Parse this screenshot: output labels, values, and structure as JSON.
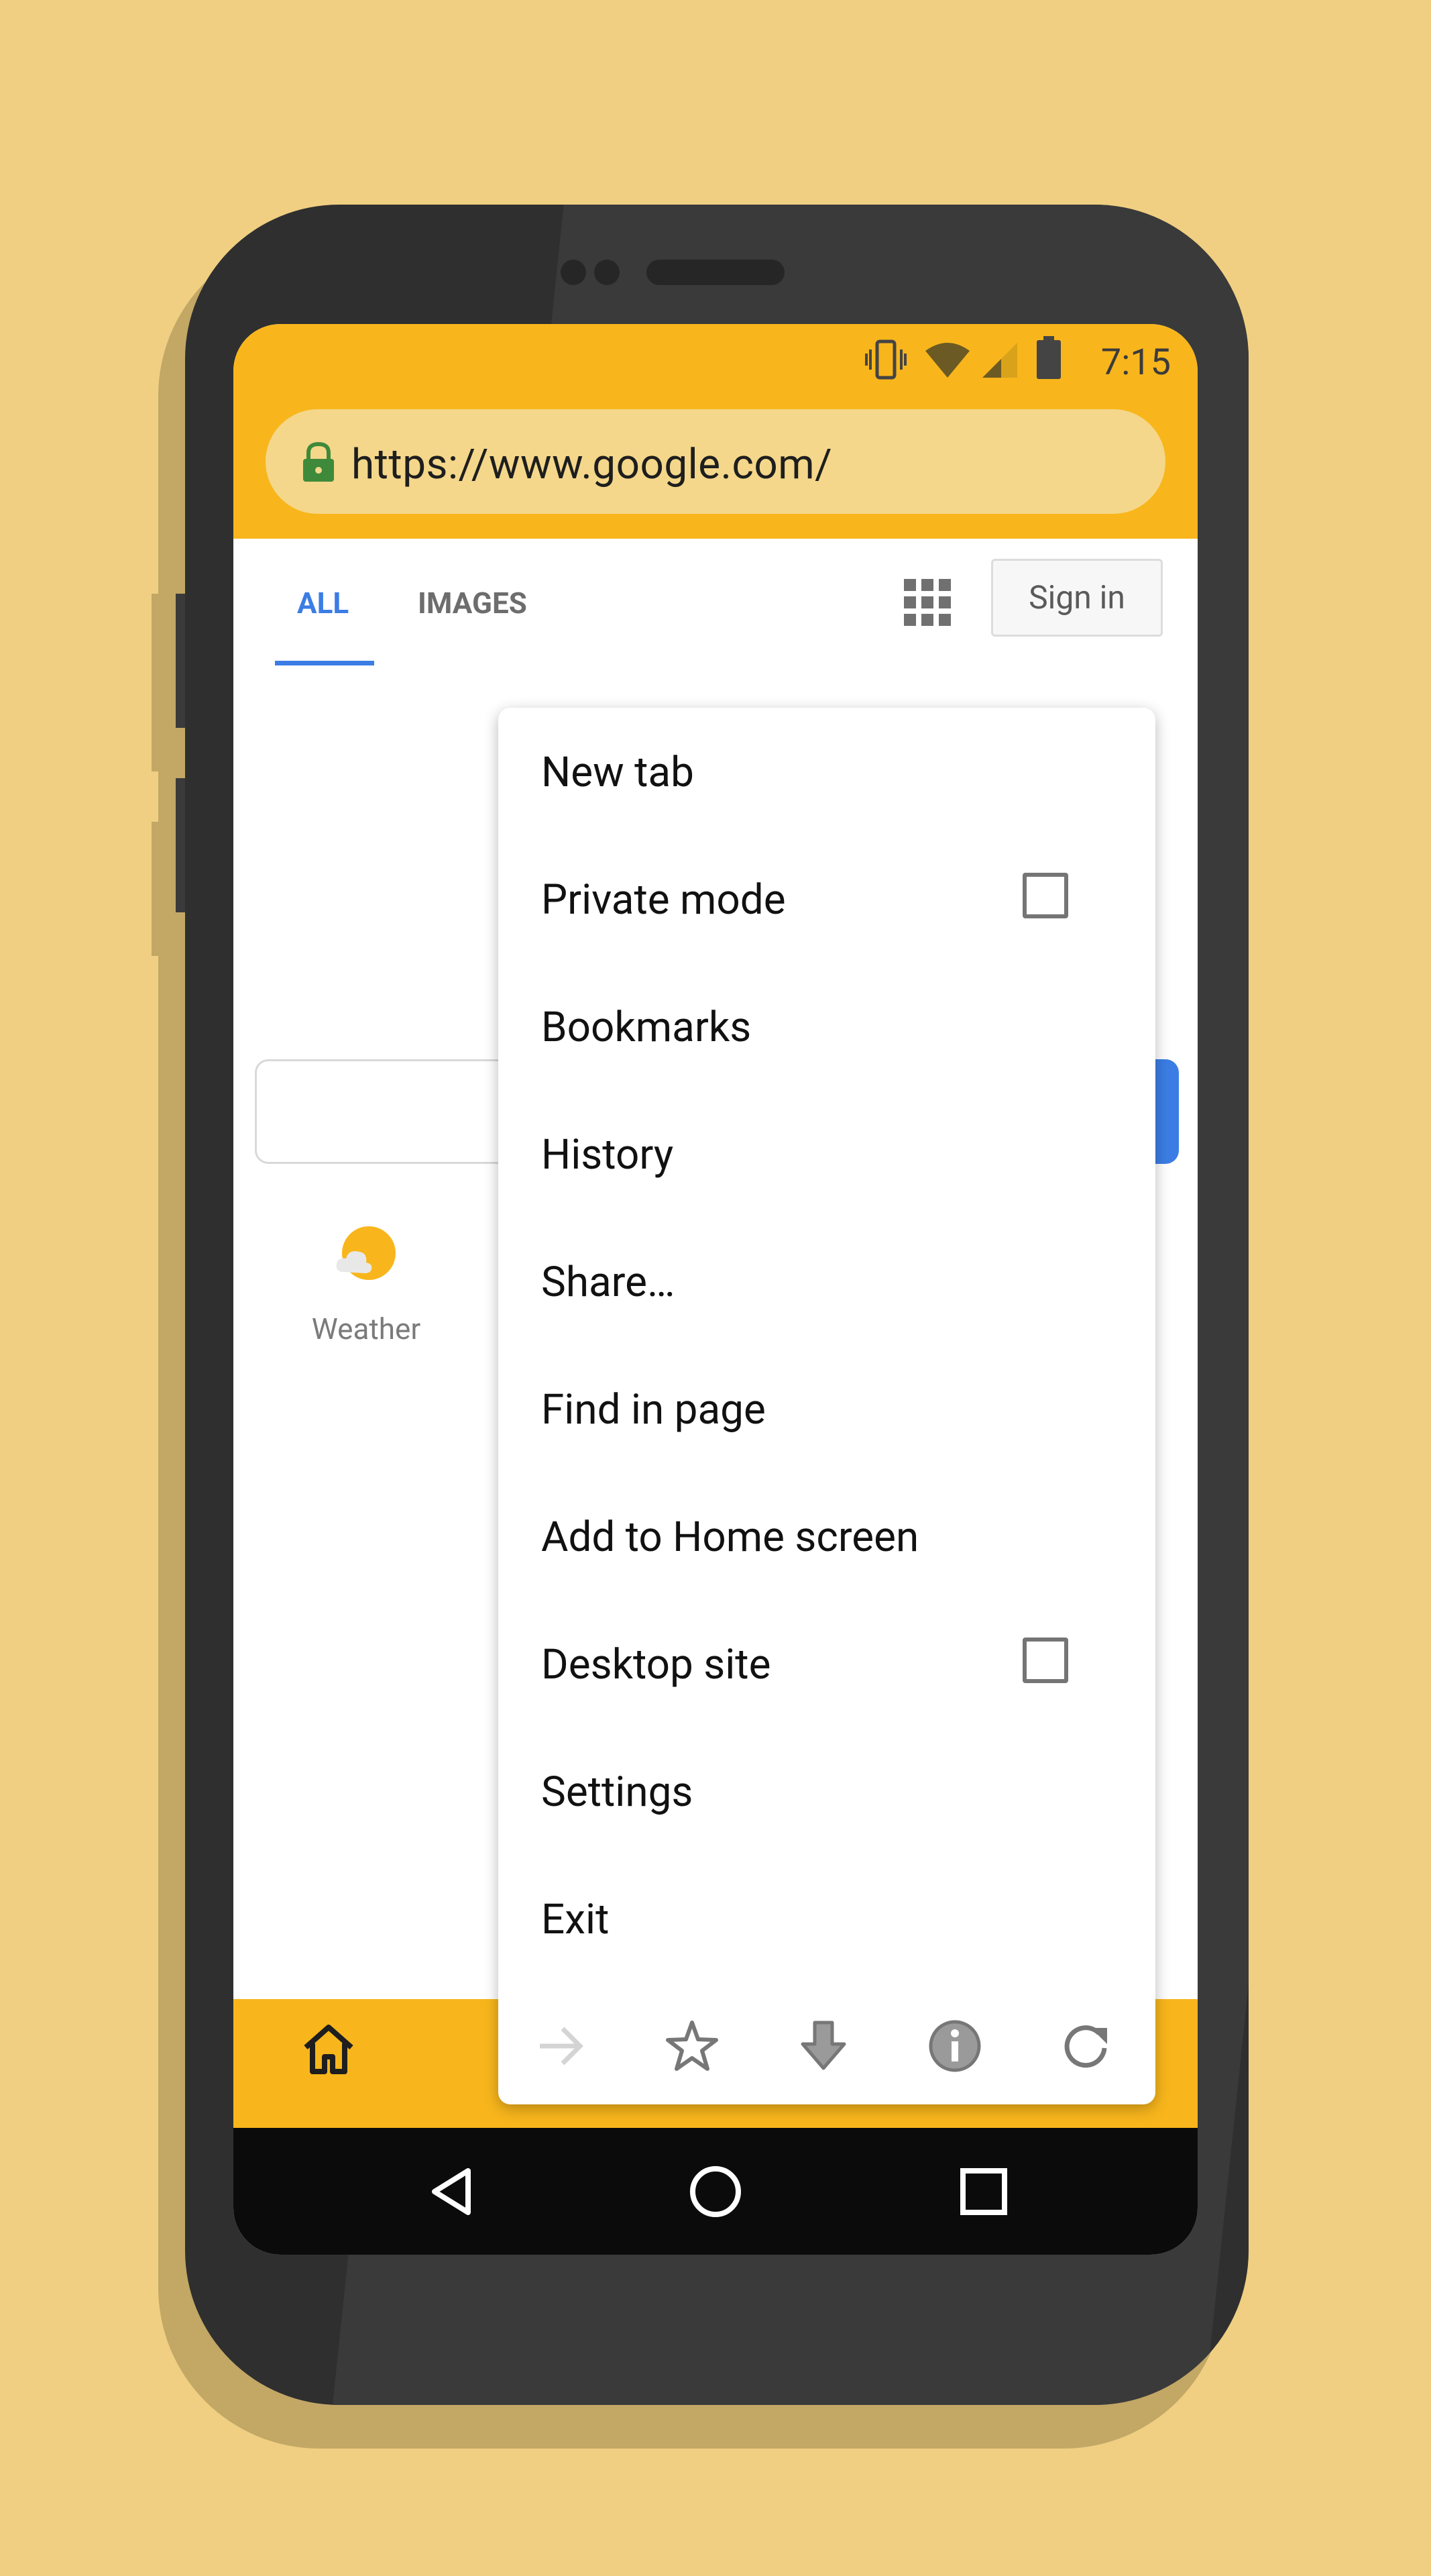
{
  "status_bar": {
    "time": "7:15"
  },
  "address_bar": {
    "url": "https://www.google.com/"
  },
  "google": {
    "tabs": [
      "ALL",
      "IMAGES"
    ],
    "sign_in": "Sign in",
    "shortcut_label": "Weather"
  },
  "menu": {
    "items": [
      {
        "label": "New tab",
        "has_checkbox": false
      },
      {
        "label": "Private mode",
        "has_checkbox": true,
        "checked": false
      },
      {
        "label": "Bookmarks",
        "has_checkbox": false
      },
      {
        "label": "History",
        "has_checkbox": false
      },
      {
        "label": "Share…",
        "has_checkbox": false
      },
      {
        "label": "Find in page",
        "has_checkbox": false
      },
      {
        "label": "Add to Home screen",
        "has_checkbox": false
      },
      {
        "label": "Desktop site",
        "has_checkbox": true,
        "checked": false
      },
      {
        "label": "Settings",
        "has_checkbox": false
      },
      {
        "label": "Exit",
        "has_checkbox": false
      }
    ],
    "icon_row": [
      "forward-icon",
      "star-icon",
      "download-icon",
      "info-icon",
      "refresh-icon"
    ]
  },
  "bottom_bar": {
    "icons": [
      "home-icon"
    ]
  },
  "nav_bar": {
    "icons": [
      "back-icon",
      "home-circle-icon",
      "recents-icon"
    ]
  },
  "colors": {
    "background": "#f0cf82",
    "app_bar": "#f8b61c",
    "url_field": "#f4d78a",
    "accent_blue": "#3b7de4",
    "phone_body": "#2f2f2f"
  }
}
